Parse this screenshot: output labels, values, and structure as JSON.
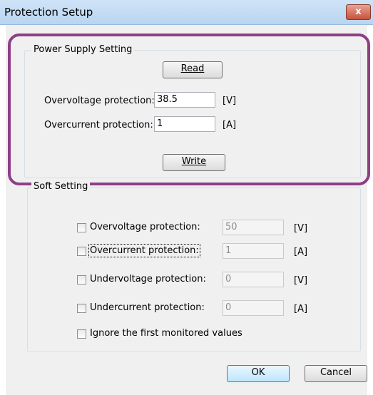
{
  "window": {
    "title": "Protection Setup",
    "close_glyph": "x"
  },
  "power_supply": {
    "group_label": "Power Supply Setting",
    "read_label": "Read",
    "ovp_label": "Overvoltage protection:",
    "ovp_value": "38.5",
    "ovp_unit": "[V]",
    "ocp_label": "Overcurrent protection:",
    "ocp_value": "1",
    "ocp_unit": "[A]",
    "write_label": "Write"
  },
  "soft": {
    "group_label": "Soft Setting",
    "items": [
      {
        "label": "Overvoltage protection:",
        "value": "50",
        "unit": "[V]"
      },
      {
        "label": "Overcurrent protection:",
        "value": "1",
        "unit": "[A]"
      },
      {
        "label": "Undervoltage protection:",
        "value": "0",
        "unit": "[V]"
      },
      {
        "label": "Undercurrent protection:",
        "value": "0",
        "unit": "[A]"
      }
    ],
    "ignore_label": "Ignore the first monitored values"
  },
  "footer": {
    "ok_label": "OK",
    "cancel_label": "Cancel"
  },
  "colors": {
    "highlight": "#8e3f86",
    "title_bar": "#c4dcf4",
    "close": "#c9523c"
  }
}
